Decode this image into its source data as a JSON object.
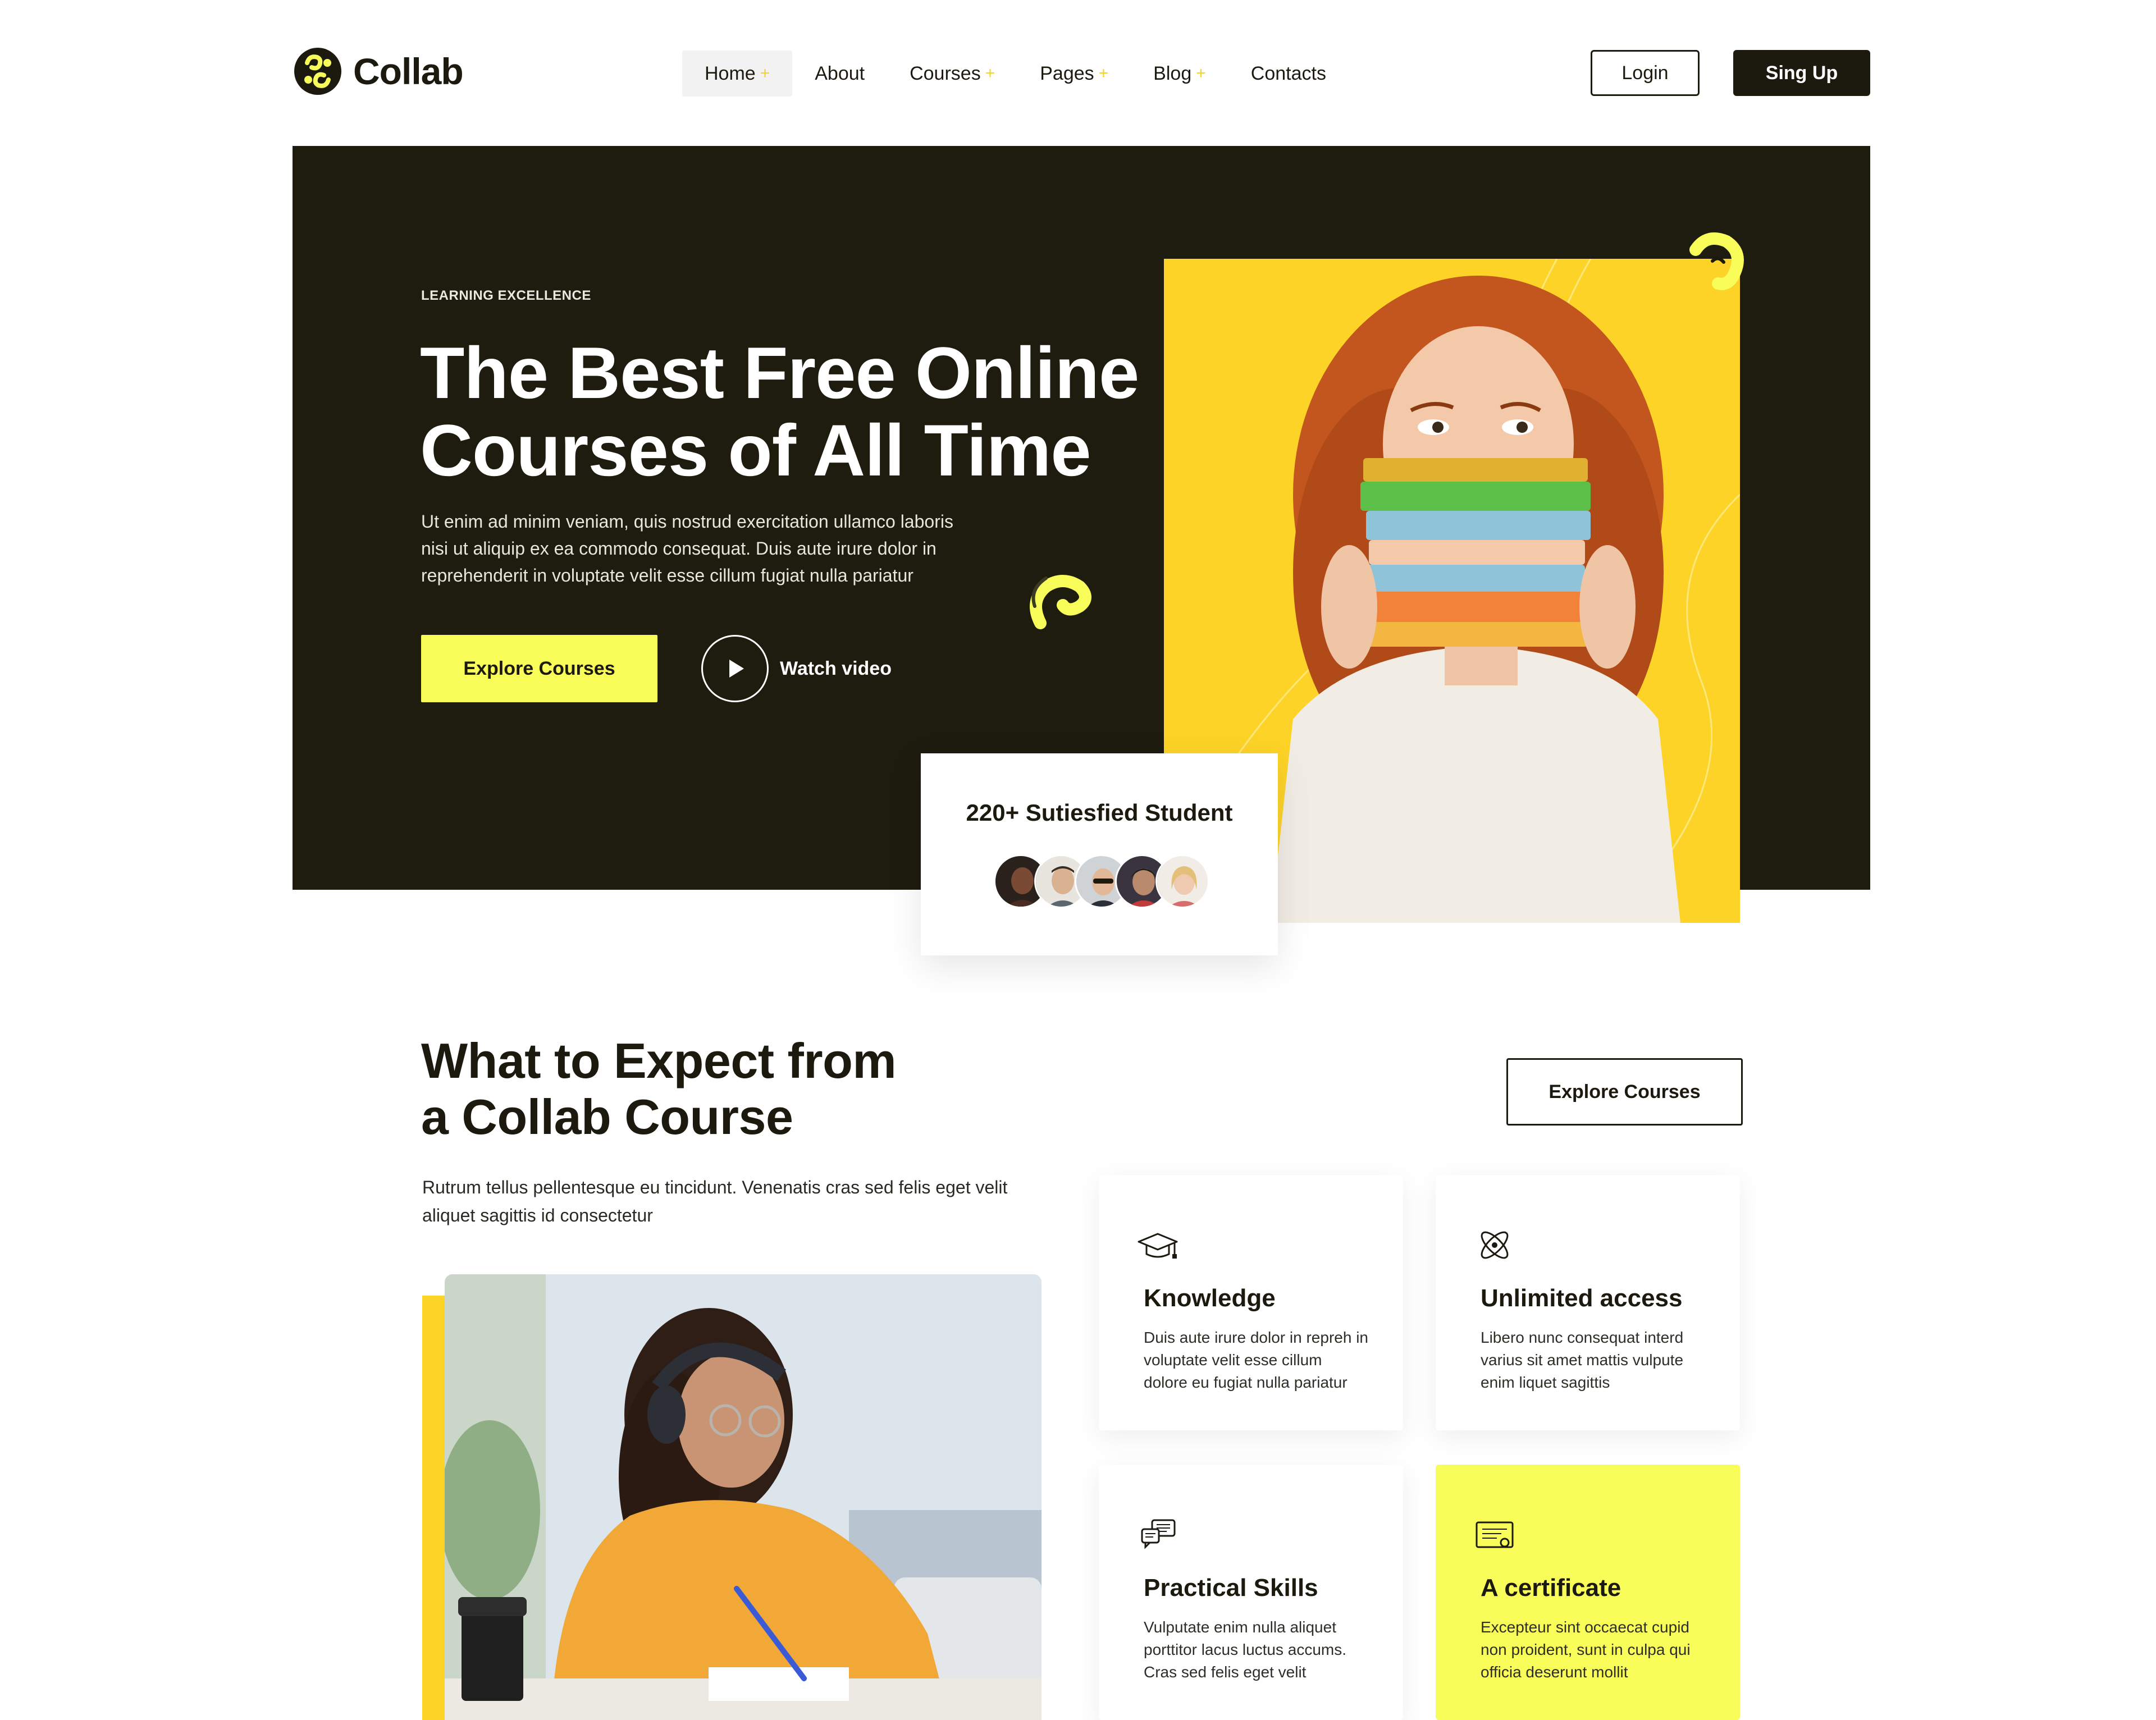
{
  "header": {
    "logo_text": "Collab",
    "nav": [
      {
        "label": "Home",
        "has_submenu": true,
        "active": true
      },
      {
        "label": "About",
        "has_submenu": false
      },
      {
        "label": "Courses",
        "has_submenu": true
      },
      {
        "label": "Pages",
        "has_submenu": true
      },
      {
        "label": "Blog",
        "has_submenu": true
      },
      {
        "label": "Contacts",
        "has_submenu": false
      }
    ],
    "submenu_marker": "+",
    "login_label": "Login",
    "signup_label": "Sing Up"
  },
  "hero": {
    "eyebrow": "LEARNING EXCELLENCE",
    "title_line1": "The Best Free Online",
    "title_line2": "Courses of All Time",
    "description": "Ut enim ad minim veniam, quis nostrud exercitation ullamco laboris nisi ut aliquip ex ea commodo consequat. Duis aute irure dolor in reprehenderit in voluptate velit esse cillum fugiat nulla pariatur",
    "explore_label": "Explore Courses",
    "watch_label": "Watch video",
    "stat_text": "220+ Sutiesfied Student"
  },
  "features_section": {
    "title_line1": "What to Expect from",
    "title_line2": "a Collab Course",
    "description": "Rutrum tellus pellentesque eu tincidunt. Venenatis cras sed felis eget velit aliquet sagittis id consectetur",
    "explore_label": "Explore Courses",
    "features": [
      {
        "title": "Knowledge",
        "description": "Duis aute irure dolor in repreh in voluptate velit esse cillum dolore eu fugiat nulla pariatur",
        "icon": "graduation-cap-icon"
      },
      {
        "title": "Unlimited access",
        "description": "Libero nunc consequat interd varius sit amet mattis vulpute enim liquet sagittis",
        "icon": "atom-icon"
      },
      {
        "title": "Practical Skills",
        "description": "Vulputate enim nulla aliquet porttitor lacus luctus accums. Cras sed felis eget velit",
        "icon": "chat-bubbles-icon"
      },
      {
        "title": "A certificate",
        "description": "Excepteur sint occaecat cupid non proident, sunt in culpa qui officia deserunt mollit",
        "icon": "certificate-icon"
      }
    ]
  },
  "colors": {
    "dark": "#1e1c0e",
    "yellow_accent": "#f8fd5a",
    "photo_yellow": "#fdd328",
    "white": "#ffffff"
  }
}
